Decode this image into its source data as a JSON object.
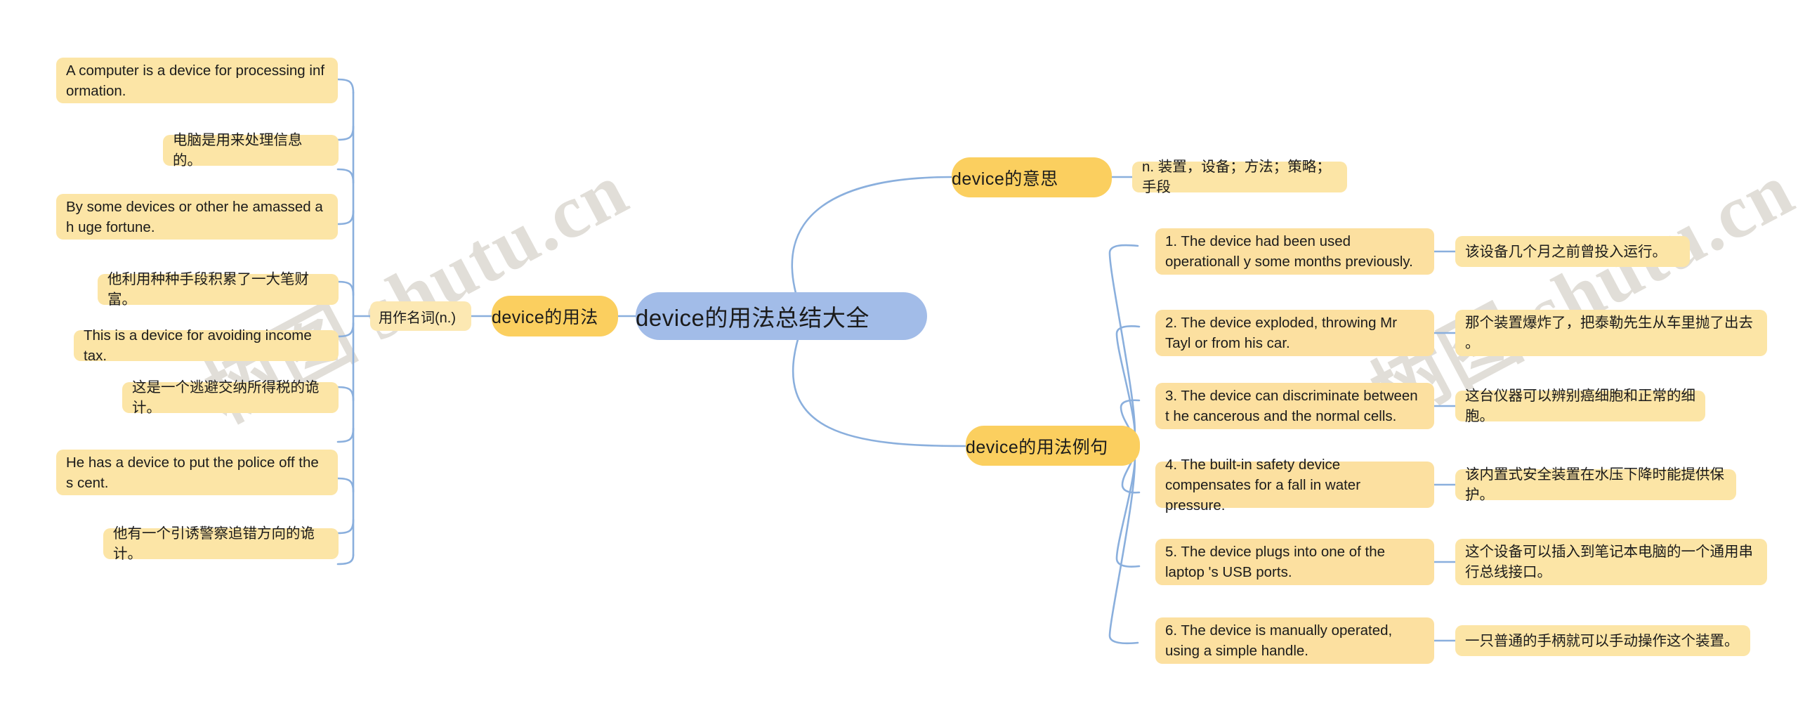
{
  "meta": {
    "watermark_text": "树图 shutu.cn",
    "background_color": "#ffffff",
    "link_color": "#8aafdd",
    "root_color": "#a2bce8",
    "branch_color": "#fbcf5f",
    "leaf_color": "#fce5a6"
  },
  "root": {
    "label": "device的用法总结大全"
  },
  "branches": {
    "usage": {
      "label": "device的用法",
      "sub": {
        "label": "用作名词(n.)"
      },
      "leaves": [
        {
          "text": "A computer is a device for processing inf ormation.",
          "lang": "en"
        },
        {
          "text": "电脑是用来处理信息的。",
          "lang": "cn"
        },
        {
          "text": "By some devices or other he amassed a h uge fortune.",
          "lang": "en"
        },
        {
          "text": "他利用种种手段积累了一大笔财富。",
          "lang": "cn"
        },
        {
          "text": "This is a device for avoiding income tax.",
          "lang": "en"
        },
        {
          "text": "这是一个逃避交纳所得税的诡计。",
          "lang": "cn"
        },
        {
          "text": "He has a device to put the police off the s cent.",
          "lang": "en"
        },
        {
          "text": "他有一个引诱警察追错方向的诡计。",
          "lang": "cn"
        }
      ]
    },
    "meaning": {
      "label": "device的意思",
      "definition": "n. 装置，设备；方法；策略；手段"
    },
    "examples": {
      "label": "device的用法例句",
      "items": [
        {
          "en": "1. The device had been used operationall y some months previously.",
          "cn": "该设备几个月之前曾投入运行。"
        },
        {
          "en": "2. The device exploded, throwing Mr Tayl or from his car.",
          "cn": "那个装置爆炸了，把泰勒先生从车里抛了出去 。"
        },
        {
          "en": "3. The device can discriminate between t he cancerous and the normal cells.",
          "cn": "这台仪器可以辨别癌细胞和正常的细胞。"
        },
        {
          "en": "4. The built-in safety device compensates  for a fall in water pressure.",
          "cn": "该内置式安全装置在水压下降时能提供保护。"
        },
        {
          "en": "5. The device plugs into one of the laptop 's USB ports.",
          "cn": "这个设备可以插入到笔记本电脑的一个通用串 行总线接口。"
        },
        {
          "en": "6. The device is manually operated, using a simple handle.",
          "cn": "一只普通的手柄就可以手动操作这个装置。"
        }
      ]
    }
  }
}
